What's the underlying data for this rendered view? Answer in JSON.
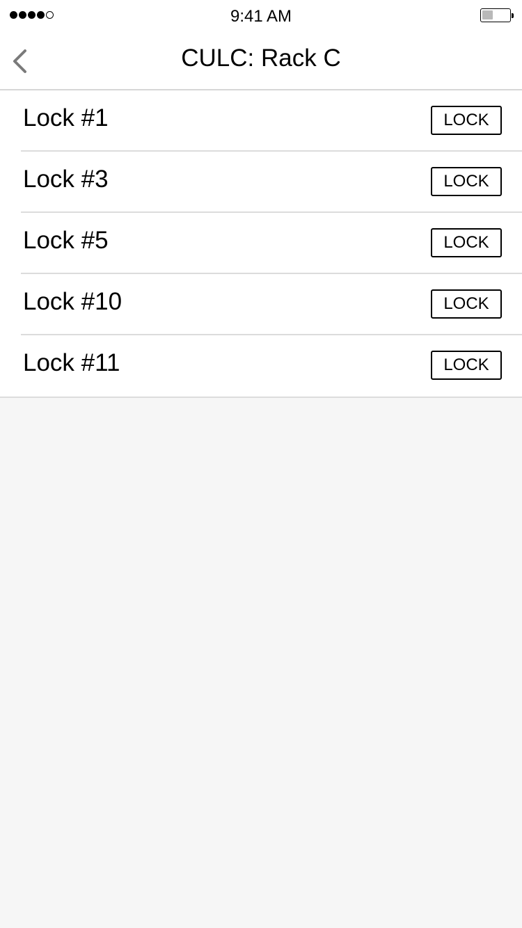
{
  "status_bar": {
    "time": "9:41 AM",
    "signal_bars_filled": 4,
    "signal_bars_total": 5,
    "battery_level": 0.4
  },
  "nav": {
    "title": "CULC: Rack C",
    "back_icon": "chevron-left-icon"
  },
  "locks": [
    {
      "label": "Lock #1",
      "button": "LOCK"
    },
    {
      "label": "Lock #3",
      "button": "LOCK"
    },
    {
      "label": "Lock #5",
      "button": "LOCK"
    },
    {
      "label": "Lock #10",
      "button": "LOCK"
    },
    {
      "label": "Lock #11",
      "button": "LOCK"
    }
  ],
  "colors": {
    "background": "#f6f6f6",
    "separator": "#dcdcdc",
    "back_chevron": "#7a7a7a"
  }
}
